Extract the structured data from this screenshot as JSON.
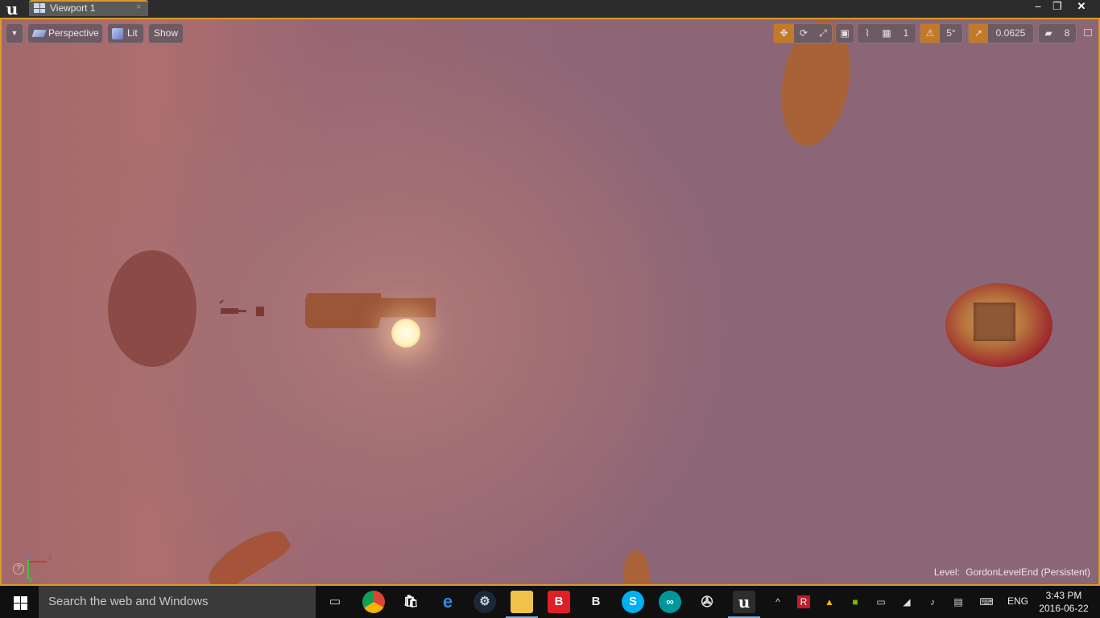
{
  "titlebar": {
    "tab_label": "Viewport 1",
    "tab_close": "×",
    "min_glyph": "–",
    "max_glyph": "❐",
    "close_glyph": "✕"
  },
  "viewport": {
    "menu_glyph": "▼",
    "perspective_label": "Perspective",
    "lit_label": "Lit",
    "show_label": "Show",
    "grid_snap_value": "1",
    "rotation_snap_value": "5°",
    "scale_snap_value": "0.0625",
    "camera_speed_value": "8",
    "level_label": "Level:",
    "level_name": "GordonLevelEnd (Persistent)",
    "axis_x": "x",
    "axis_y": "y",
    "axis_z": "z",
    "help_glyph": "?",
    "accent_color": "#d99a2b"
  },
  "taskbar": {
    "search_placeholder": "Search the web and Windows",
    "language": "ENG",
    "time": "3:43 PM",
    "date": "2016-06-22",
    "icons": [
      "task-view",
      "chrome",
      "store",
      "edge",
      "steam",
      "file-explorer",
      "bitdefender",
      "iis",
      "skype",
      "arduino",
      "obs",
      "unreal-engine"
    ]
  }
}
